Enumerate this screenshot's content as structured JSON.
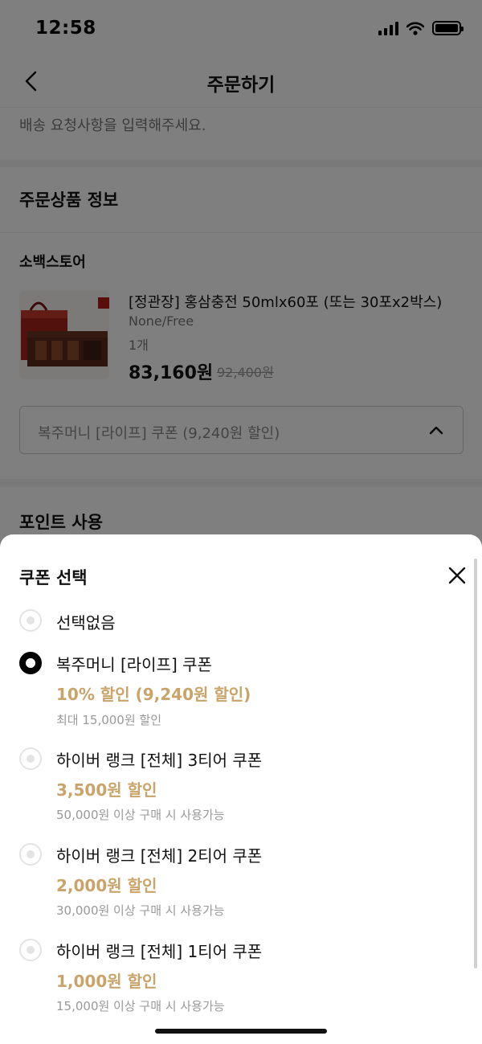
{
  "status_bar": {
    "time": "12:58"
  },
  "header": {
    "title": "주문하기"
  },
  "delivery": {
    "placeholder": "배송 요청사항을 입력해주세요."
  },
  "order_info": {
    "section_title": "주문상품 정보",
    "store": "소백스토어",
    "product": {
      "name": "[정관장] 홍삼충전 50mlx60포 (또는 30포x2박스)",
      "option": "None/Free",
      "quantity": "1개",
      "price": "83,160원",
      "original_price": "92,400원"
    },
    "coupon_select": {
      "label": "복주머니 [라이프] 쿠폰 (9,240원 할인)"
    }
  },
  "points": {
    "section_title": "포인트 사용"
  },
  "coupon_sheet": {
    "title": "쿠폰 선택",
    "options": [
      {
        "name": "선택없음",
        "discount": "",
        "condition": "",
        "selected": false
      },
      {
        "name": "복주머니 [라이프] 쿠폰",
        "discount": "10% 할인 (9,240원 할인)",
        "condition": "최대 15,000원 할인",
        "selected": true
      },
      {
        "name": "하이버 랭크 [전체] 3티어 쿠폰",
        "discount": "3,500원 할인",
        "condition": "50,000원 이상 구매 시 사용가능",
        "selected": false
      },
      {
        "name": "하이버 랭크 [전체] 2티어 쿠폰",
        "discount": "2,000원 할인",
        "condition": "30,000원 이상 구매 시 사용가능",
        "selected": false
      },
      {
        "name": "하이버 랭크 [전체] 1티어 쿠폰",
        "discount": "1,000원 할인",
        "condition": "15,000원 이상 구매 시 사용가능",
        "selected": false
      }
    ]
  },
  "colors": {
    "discount_accent": "#c9a46a",
    "overlay": "rgba(0,0,0,0.5)"
  },
  "icons": [
    "back-icon",
    "close-icon",
    "chevron-up-icon",
    "radio-icon"
  ]
}
